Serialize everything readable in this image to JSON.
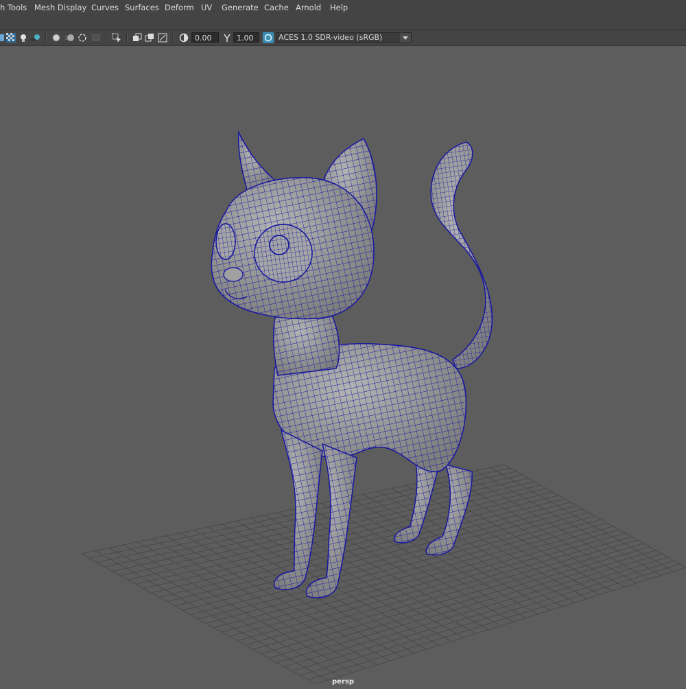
{
  "menu": {
    "items": [
      {
        "label": "h Tools"
      },
      {
        "label": "Mesh Display"
      },
      {
        "label": "Curves"
      },
      {
        "label": "Surfaces"
      },
      {
        "label": "Deform"
      },
      {
        "label": "UV"
      },
      {
        "label": "Generate"
      },
      {
        "label": "Cache"
      },
      {
        "label": "Arnold"
      },
      {
        "label": "Help"
      }
    ]
  },
  "toolbar": {
    "exposure_value": "0.00",
    "gamma_value": "1.00",
    "color_space": "ACES 1.0 SDR-video (sRGB)",
    "icons": [
      "grid-icon",
      "checker-icon",
      "light-icon",
      "shadow-icon",
      "ao-icon",
      "motion-blur-icon",
      "aa-icon",
      "isolate-icon",
      "select-icon",
      "xray-icon",
      "xray-active-icon",
      "xray-joints-icon",
      "exposure-icon",
      "gamma-icon",
      "color-management-icon",
      "dropdown-arrow-icon"
    ]
  },
  "viewport": {
    "camera_label": "persp",
    "background_color": "#5d5d5d",
    "wireframe_color": "#1a1aa0",
    "mesh_color": "#9a9a9a",
    "grid_color": "#4a4a4a"
  }
}
